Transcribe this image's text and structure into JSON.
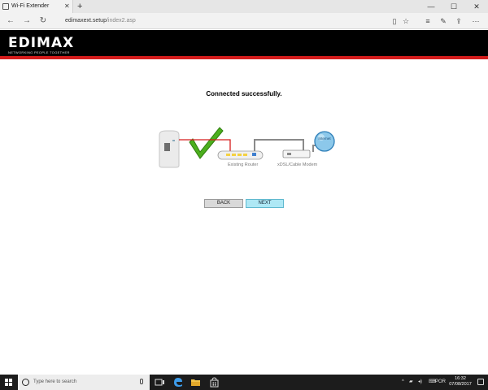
{
  "browser": {
    "tab_title": "Wi-Fi Extender",
    "tab_close": "✕",
    "new_tab": "+",
    "minimize": "—",
    "maximize": "☐",
    "close": "✕",
    "url_host": "edimaxext.setup",
    "url_path": "/index2.asp",
    "icons": [
      "back-arrow-icon",
      "forward-arrow-icon",
      "refresh-icon",
      "reading-view-icon",
      "favorite-star-icon",
      "hub-icon",
      "notes-icon",
      "share-icon",
      "more-icon"
    ]
  },
  "header": {
    "logo": "EDIMAX",
    "tagline": "NETWORKING PEOPLE TOGETHER",
    "colors": {
      "bar": "#000000",
      "accent": "#d51c1c"
    }
  },
  "content": {
    "headline": "Connected successfully.",
    "diagram": {
      "router_label": "Existing Router",
      "modem_label": "xDSL/Cable Modem",
      "internet_label": "Internet",
      "colors": {
        "check": "#4caf1e",
        "red_cable": "#d51c1c",
        "gray_cable": "#8a8a8a",
        "router_ports": "#f5d142",
        "globe": "#8cc8ea"
      }
    },
    "back_button": "BACK",
    "next_button": "NEXT"
  },
  "taskbar": {
    "search_placeholder": "Type here to search",
    "language": "POR",
    "time": "16:32",
    "date": "07/08/2017",
    "icons": [
      "windows-start-icon",
      "search-circle-icon",
      "microphone-icon",
      "task-view-icon",
      "edge-icon",
      "file-explorer-icon",
      "store-icon",
      "tray-chevron-icon",
      "network-icon",
      "volume-icon",
      "keyboard-icon",
      "notifications-icon"
    ]
  }
}
